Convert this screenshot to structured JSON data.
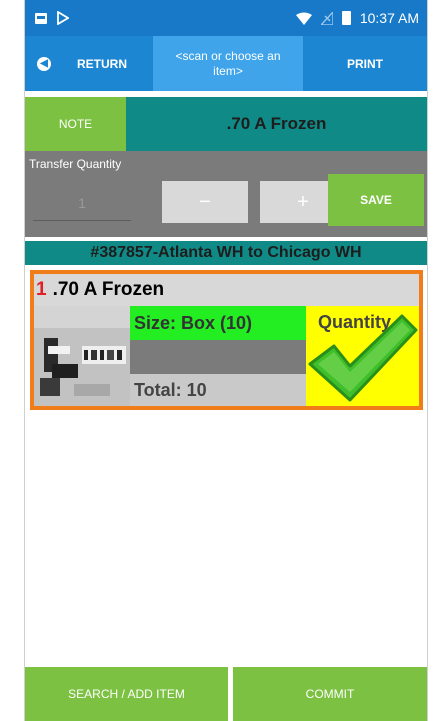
{
  "status_bar": {
    "time": "10:37 AM",
    "icons": [
      "image-icon",
      "play-store-icon",
      "wifi-icon",
      "no-signal-icon",
      "battery-icon"
    ]
  },
  "header": {
    "return_label": "RETURN",
    "scan_placeholder": "<scan or choose an item>",
    "print_label": "PRINT"
  },
  "note": {
    "button_label": "NOTE",
    "item_title": ".70 A Frozen"
  },
  "transfer": {
    "label": "Transfer Quantity",
    "quantity_value": "1",
    "minus_label": "−",
    "plus_label": "+",
    "save_label": "SAVE"
  },
  "transfer_title": "#387857-Atlanta WH to Chicago WH",
  "items": [
    {
      "index": "1",
      "name": ".70 A Frozen",
      "size": "Size: Box (10)",
      "total": "Total: 10",
      "quantity_label": "Quantity",
      "checked": true
    }
  ],
  "bottom": {
    "search_label": "SEARCH / ADD ITEM",
    "commit_label": "COMMIT"
  },
  "colors": {
    "status_blue": "#1779c8",
    "header_blue": "#1d86d2",
    "scan_blue": "#3fa4ea",
    "green": "#7cc142",
    "teal": "#0f8a86",
    "gray": "#7b7b7b",
    "orange": "#f07c1a",
    "size_green": "#22ee22",
    "yellow": "#ffff00",
    "red_index": "#e01f26"
  }
}
